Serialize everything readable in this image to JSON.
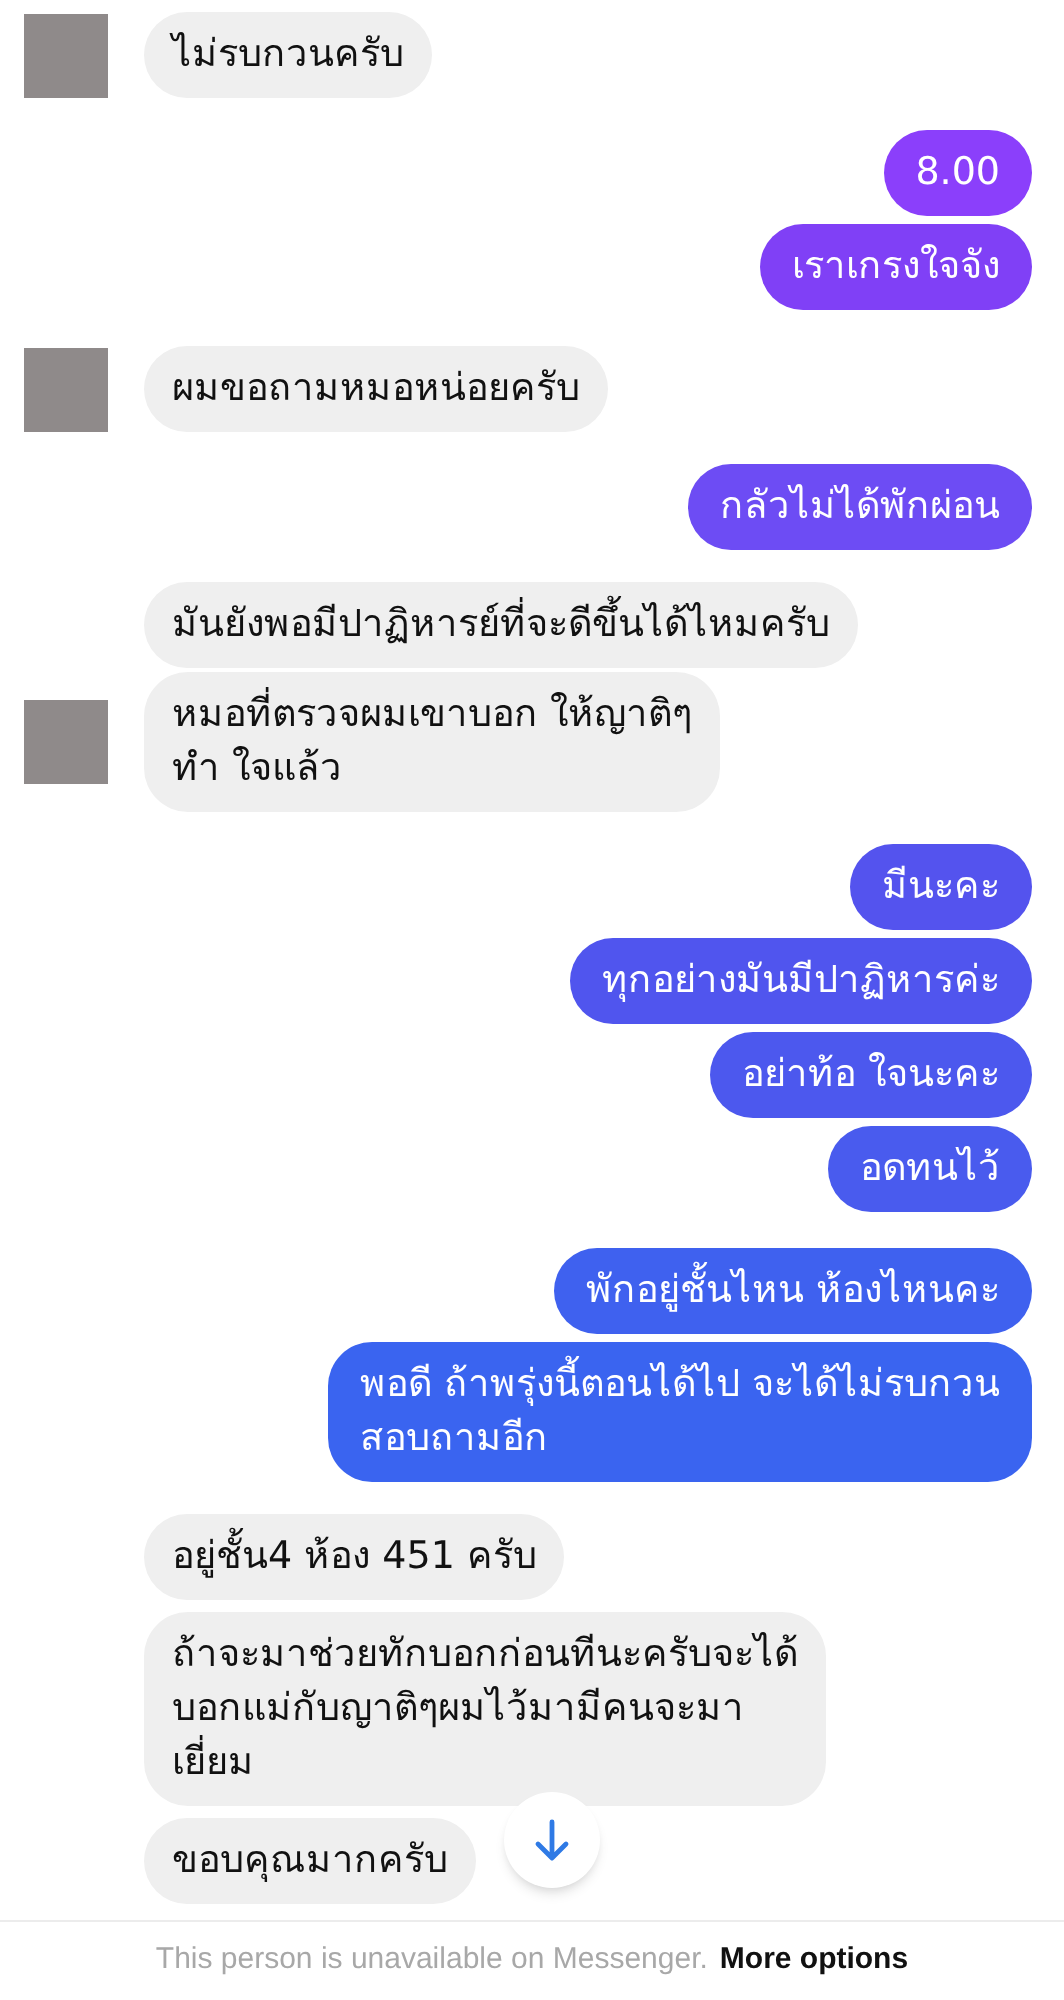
{
  "messages": [
    {
      "kind": "them",
      "avatar": true,
      "text": "ไม่รบกวนครับ"
    },
    {
      "kind": "me",
      "color": "#8b3ffb",
      "text": "8.00"
    },
    {
      "kind": "me",
      "color": "#8040f6",
      "text": "เราเกรงใจจัง"
    },
    {
      "kind": "them",
      "avatar": true,
      "text": "ผมขอถามหมอหน่อยครับ"
    },
    {
      "kind": "me",
      "color": "#6d4cf4",
      "text": "กลัวไม่ได้พักผ่อน"
    },
    {
      "kind": "them",
      "avatar": false,
      "text": "มันยังพอมีปาฏิหารย์ที่จะดีขึ้นได้ไหมครับ"
    },
    {
      "kind": "them",
      "avatar": true,
      "text": "หมอที่ตรวจผมเขาบอก ให้ญาติๆ\nทำ ใจแล้ว"
    },
    {
      "kind": "me",
      "color": "#5453ee",
      "text": "มีนะคะ"
    },
    {
      "kind": "me",
      "color": "#5055ee",
      "text": "ทุกอย่างมันมีปาฏิหารค่ะ"
    },
    {
      "kind": "me",
      "color": "#4c58ee",
      "text": "อย่าท้อ ใจนะคะ"
    },
    {
      "kind": "me",
      "color": "#495bee",
      "text": "อดทนไว้"
    },
    {
      "kind": "me",
      "color": "#3f61ef",
      "text": "พักอยู่ชั้นไหน ห้องไหนคะ"
    },
    {
      "kind": "me",
      "color": "#3a64f0",
      "text": "พอดี ถ้าพรุ่งนี้ตอนได้ไป จะได้ไม่รบกวน\nสอบถามอีก"
    },
    {
      "kind": "them",
      "avatar": false,
      "text": "อยู่ชั้น4 ห้อง 451 ครับ"
    },
    {
      "kind": "them",
      "avatar": false,
      "text": "ถ้าจะมาช่วยทักบอกก่อนทีนะครับจะได้\nบอกแม่กับญาติๆผมไว้มามีคนจะมา\nเยี่ยม"
    },
    {
      "kind": "them",
      "avatar": false,
      "text": "ขอบคุณมากครับ"
    }
  ],
  "footer": {
    "notice": "This person is unavailable on Messenger.",
    "link": "More options"
  }
}
